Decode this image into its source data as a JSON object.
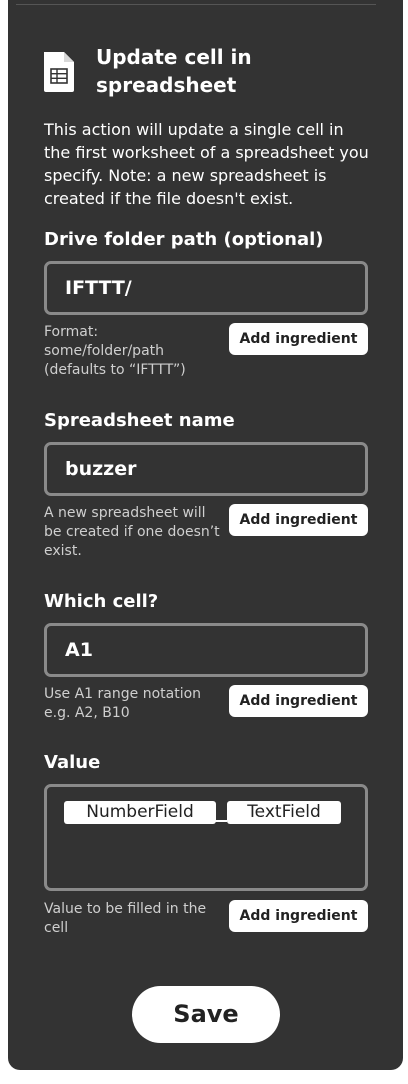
{
  "action": {
    "icon": "spreadsheet-document-icon",
    "title": "Update cell in spreadsheet",
    "description": "This action will update a single cell in the first worksheet of a spreadsheet you specify. Note: a new spreadsheet is created if the file doesn't exist."
  },
  "fields": [
    {
      "label": "Drive folder path (optional)",
      "value": "IFTTT/",
      "helper": "Format: some/folder/path (defaults to “IFTTT”)",
      "button": "Add ingredient"
    },
    {
      "label": "Spreadsheet name",
      "value": "buzzer",
      "helper": "A new spreadsheet will be created if one doesn’t exist.",
      "button": "Add ingredient"
    },
    {
      "label": "Which cell?",
      "value": "A1",
      "helper": "Use A1 range notation e.g. A2, B10",
      "button": "Add ingredient"
    },
    {
      "label": "Value",
      "ingredients": [
        "NumberField",
        "TextField"
      ],
      "separator": "_",
      "helper": "Value to be filled in the cell",
      "button": "Add ingredient"
    }
  ],
  "save_label": "Save"
}
